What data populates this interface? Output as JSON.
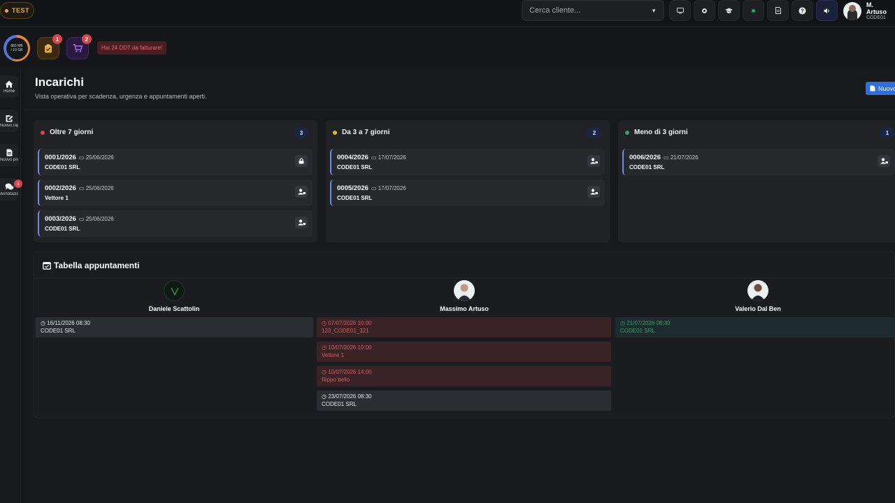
{
  "env_badge": "TEST",
  "search": {
    "placeholder": "Cerca cliente..."
  },
  "toolbar_icons": [
    "monitor-icon",
    "circle-icon",
    "graduation-icon",
    "status-icon",
    "document-icon",
    "help-icon",
    "volume-icon"
  ],
  "user": {
    "name": "M. Artuso",
    "company": "CODE01"
  },
  "storage": {
    "used": "883 MB",
    "total": "/ 10 GB",
    "fraction": 0.55
  },
  "quick": {
    "tasks_badge": "1",
    "cart_badge": "2"
  },
  "alert": "Hai 24 DDT da fatturare!",
  "sidebar": [
    {
      "label": "Home",
      "icon": "home-icon"
    },
    {
      "label": "Nuovo rap...",
      "icon": "edit-icon"
    },
    {
      "label": "Nuovo pre...",
      "icon": "file-icon"
    },
    {
      "label": "Annotazio...",
      "icon": "chat-icon",
      "badge": "1"
    }
  ],
  "page": {
    "title": "Incarichi",
    "subtitle": "Vista operativa per scadenza, urgenza e appuntamenti aperti.",
    "new_button": "Nuovo"
  },
  "columns": [
    {
      "title": "Oltre 7 giorni",
      "count": "3",
      "color": "#d9454b",
      "cards": [
        {
          "num": "0001/2026",
          "date": "25/06/2026",
          "client": "CODE01 SRL",
          "icon": "lock-icon"
        },
        {
          "num": "0002/2026",
          "date": "25/06/2026",
          "client": "Vettore 1",
          "icon": "user-assign-icon"
        },
        {
          "num": "0003/2026",
          "date": "25/06/2026",
          "client": "CODE01 SRL",
          "icon": "user-assign-icon"
        }
      ]
    },
    {
      "title": "Da 3 a 7 giorni",
      "count": "2",
      "color": "#e5b231",
      "cards": [
        {
          "num": "0004/2026",
          "date": "17/07/2026",
          "client": "CODE01 SRL",
          "icon": "user-assign-icon"
        },
        {
          "num": "0005/2026",
          "date": "17/07/2026",
          "client": "CODE01 SRL",
          "icon": "user-assign-icon"
        }
      ]
    },
    {
      "title": "Meno di 3 giorni",
      "count": "1",
      "color": "#2fa36a",
      "cards": [
        {
          "num": "0006/2026",
          "date": "21/07/2026",
          "client": "CODE01 SRL",
          "icon": "user-assign-icon"
        }
      ]
    }
  ],
  "appointments": {
    "title": "Tabella appuntamenti",
    "people": [
      {
        "name": "Daniele Scattolin",
        "items": [
          {
            "when": "16/11/2026 08:30",
            "client": "CODE01 SRL",
            "style": "gray"
          }
        ]
      },
      {
        "name": "Massimo Artuso",
        "items": [
          {
            "when": "07/07/2026 10:00",
            "client": "123_CODE01_321",
            "style": "red"
          },
          {
            "when": "10/07/2026 10:00",
            "client": "Vettore 1",
            "style": "red"
          },
          {
            "when": "10/07/2026 14:00",
            "client": "filippo bello",
            "style": "red"
          },
          {
            "when": "23/07/2026 08:30",
            "client": "CODE01 SRL",
            "style": "gray"
          }
        ]
      },
      {
        "name": "Valerio Dal Ben",
        "items": [
          {
            "when": "21/07/2026 08:30",
            "client": "CODE01 SRL",
            "style": "green"
          }
        ]
      }
    ]
  }
}
